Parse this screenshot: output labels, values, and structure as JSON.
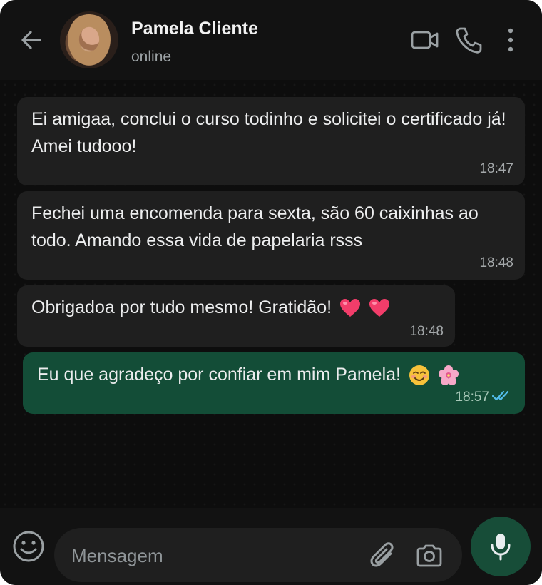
{
  "header": {
    "contact_name": "Pamela Cliente",
    "status": "online",
    "icons": [
      "back-arrow-icon",
      "video-call-icon",
      "phone-call-icon",
      "more-options-icon"
    ]
  },
  "messages": [
    {
      "direction": "incoming",
      "text": "Ei amigaa, conclui o curso todinho e solicitei o certificado já! Amei tudooo!",
      "time": "18:47"
    },
    {
      "direction": "incoming",
      "text": "Fechei uma encomenda para sexta, são 60 caixinhas ao todo. Amando essa vida de papelaria rsss",
      "time": "18:48"
    },
    {
      "direction": "incoming",
      "text": "Obrigadoa por tudo mesmo! Gratidão!",
      "emoji": [
        "heart",
        "heart"
      ],
      "time": "18:48"
    },
    {
      "direction": "outgoing",
      "text": "Eu que agradeço por confiar em mim Pamela!",
      "emoji": [
        "smiling-face",
        "cherry-blossom"
      ],
      "time": "18:57",
      "status": "read"
    }
  ],
  "composer": {
    "placeholder": "Mensagem",
    "icons": [
      "emoji-icon",
      "attach-icon",
      "camera-icon",
      "mic-icon"
    ]
  },
  "colors": {
    "background": "#0c0c0c",
    "incoming_bubble": "#1f1f1f",
    "outgoing_bubble": "#134d37",
    "read_ticks": "#53bdeb"
  }
}
